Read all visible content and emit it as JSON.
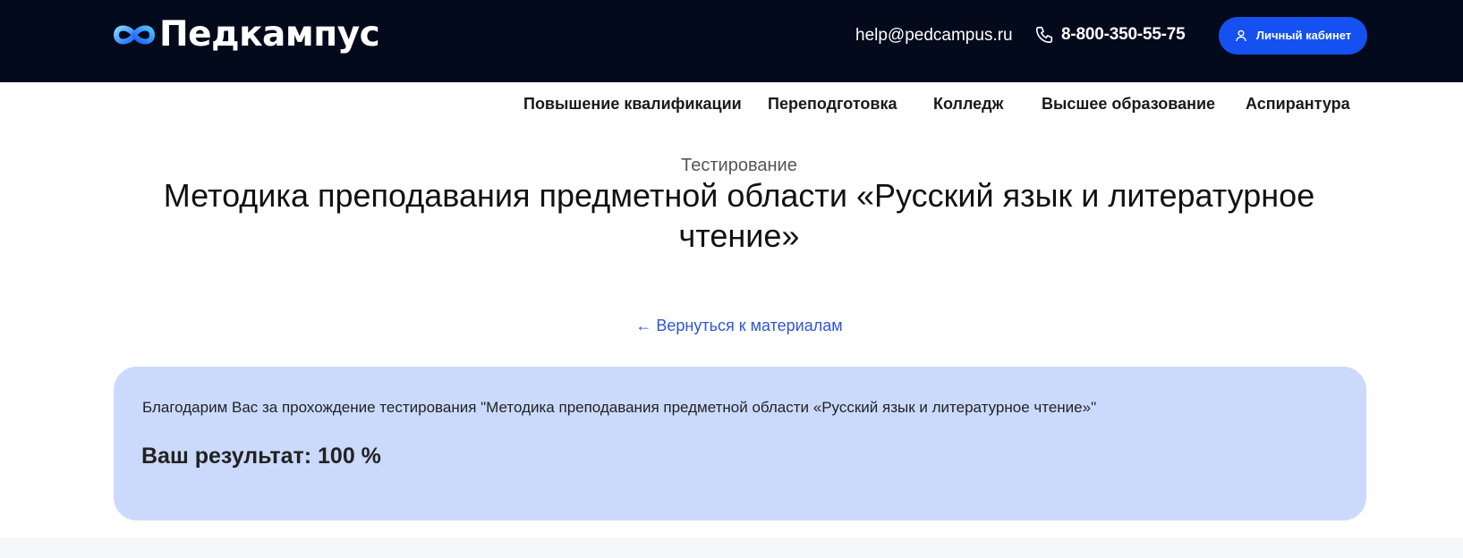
{
  "header": {
    "logo_text": "Педкампус",
    "email": "help@pedcampus.ru",
    "phone": "8-800-350-55-75",
    "cabinet_button_label": "Личный кабинет"
  },
  "nav": {
    "items": [
      {
        "label": "Повышение квалификации"
      },
      {
        "label": "Переподготовка"
      },
      {
        "label": "Колледж"
      },
      {
        "label": "Высшее образование"
      },
      {
        "label": "Аспирантура"
      }
    ]
  },
  "main": {
    "subtitle": "Тестирование",
    "title": "Методика преподавания предметной области «Русский язык и литературное чтение»",
    "back_link": "← Вернуться к материалам"
  },
  "result": {
    "thanks_text": "Благодарим Вас за прохождение тестирования \"Методика преподавания предметной области «Русский язык и литературное чтение»\"",
    "score_text": "Ваш результат: 100 %"
  },
  "colors": {
    "header_bg": "#020a1c",
    "accent": "#1551f0",
    "link": "#2f55d4",
    "card_bg": "#cbdafc"
  },
  "icons": {
    "logo": "infinity-logo-icon",
    "phone": "phone-icon",
    "user": "user-icon"
  }
}
